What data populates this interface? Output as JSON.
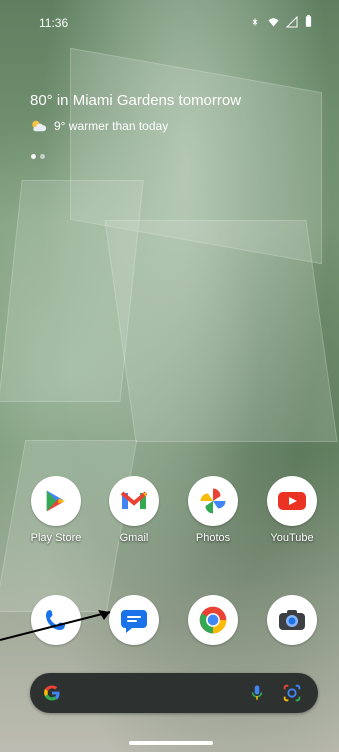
{
  "status_bar": {
    "time": "11:36",
    "icons": [
      "mute-icon",
      "wifi-icon",
      "signal-icon",
      "battery-icon"
    ]
  },
  "weather": {
    "title": "80° in Miami Gardens tomorrow",
    "subtitle": "9° warmer than today",
    "icon": "cloudy-sun-icon"
  },
  "home": {
    "page_dots": 2,
    "active_page": 1
  },
  "apps_row1": [
    {
      "label": "Play Store",
      "icon": "play-store-icon"
    },
    {
      "label": "Gmail",
      "icon": "gmail-icon"
    },
    {
      "label": "Photos",
      "icon": "photos-icon"
    },
    {
      "label": "YouTube",
      "icon": "youtube-icon"
    }
  ],
  "dock_apps": [
    {
      "icon": "phone-icon"
    },
    {
      "icon": "messages-icon"
    },
    {
      "icon": "chrome-icon"
    },
    {
      "icon": "camera-icon"
    }
  ],
  "search": {
    "icon_left": "google-g-icon",
    "icon_mic": "mic-icon",
    "icon_lens": "lens-icon"
  },
  "colors": {
    "google_blue": "#4285F4",
    "google_red": "#EA4335",
    "google_yellow": "#FBBC05",
    "google_green": "#34A853",
    "search_bg": "#2d3231"
  }
}
